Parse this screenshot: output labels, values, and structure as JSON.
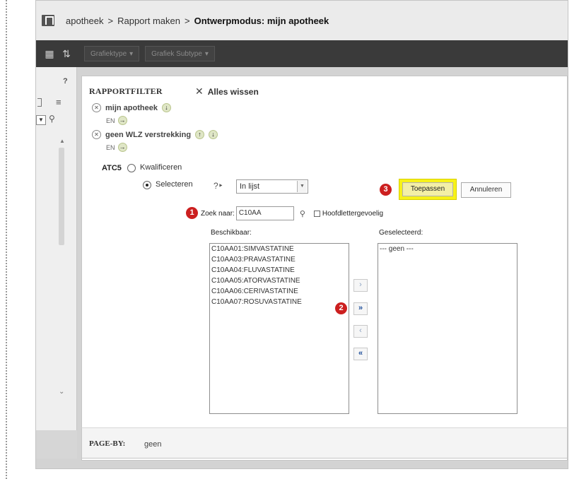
{
  "header": {
    "crumbs": [
      "apotheek",
      ">",
      "Rapport maken",
      ">"
    ],
    "current": "Ontwerpmodus: mijn apotheek"
  },
  "toolbar": {
    "chart_type": "Grafiektype",
    "chart_subtype": "Grafiek Subtype"
  },
  "filter": {
    "title": "RAPPORTFILTER",
    "clear_all": "Alles wissen",
    "conditions": [
      {
        "label": "mijn apotheek",
        "connector": "EN"
      },
      {
        "label": "geen WLZ verstrekking",
        "connector": "EN"
      }
    ],
    "atc_label": "ATC5",
    "option_qualify": "Kwalificeren",
    "option_select": "Selecteren",
    "operator": "In lijst",
    "apply": "Toepassen",
    "cancel": "Annuleren",
    "search_label": "Zoek naar:",
    "search_value": "C10AA",
    "case_sensitive": "Hoofdlettergevoelig",
    "available_label": "Beschikbaar:",
    "selected_label": "Geselecteerd:",
    "available": [
      "C10AA01:SIMVASTATINE",
      "C10AA03:PRAVASTATINE",
      "C10AA04:FLUVASTATINE",
      "C10AA05:ATORVASTATINE",
      "C10AA06:CERIVASTATINE",
      "C10AA07:ROSUVASTATINE"
    ],
    "selected": [
      "--- geen ---"
    ]
  },
  "badges": [
    "1",
    "2",
    "3"
  ],
  "page_by": {
    "label": "PAGE-BY:",
    "value": "geen"
  },
  "colors": {
    "toolbar": "#3a3a3a",
    "highlight": "#f7f218",
    "badge": "#cc1f1f"
  }
}
